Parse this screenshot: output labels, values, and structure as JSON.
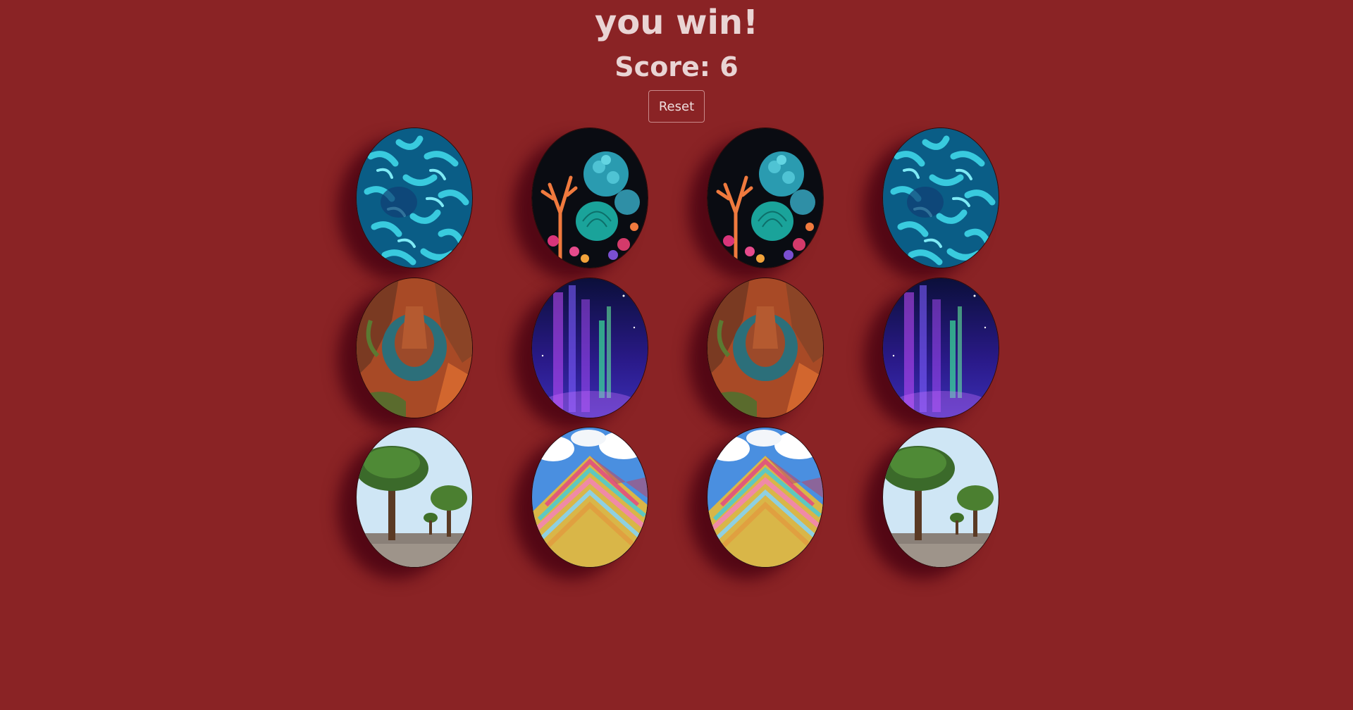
{
  "header": {
    "title": "you win!",
    "score_text": "Score: 6"
  },
  "controls": {
    "reset_label": "Reset"
  },
  "game": {
    "columns": 4,
    "rows": 3,
    "cards": [
      {
        "image": "blue-coral",
        "matched": true
      },
      {
        "image": "colorful-coral-reef",
        "matched": true
      },
      {
        "image": "colorful-coral-reef",
        "matched": true
      },
      {
        "image": "blue-coral",
        "matched": true
      },
      {
        "image": "horseshoe-canyon",
        "matched": true
      },
      {
        "image": "aurora",
        "matched": true
      },
      {
        "image": "horseshoe-canyon",
        "matched": true
      },
      {
        "image": "aurora",
        "matched": true
      },
      {
        "image": "dragon-blood-trees",
        "matched": true
      },
      {
        "image": "rainbow-mountain",
        "matched": true
      },
      {
        "image": "rainbow-mountain",
        "matched": true
      },
      {
        "image": "dragon-blood-trees",
        "matched": true
      }
    ]
  },
  "colors": {
    "background": "#8a2325",
    "text": "#e9d4d4",
    "card_shadow": "#500614"
  }
}
